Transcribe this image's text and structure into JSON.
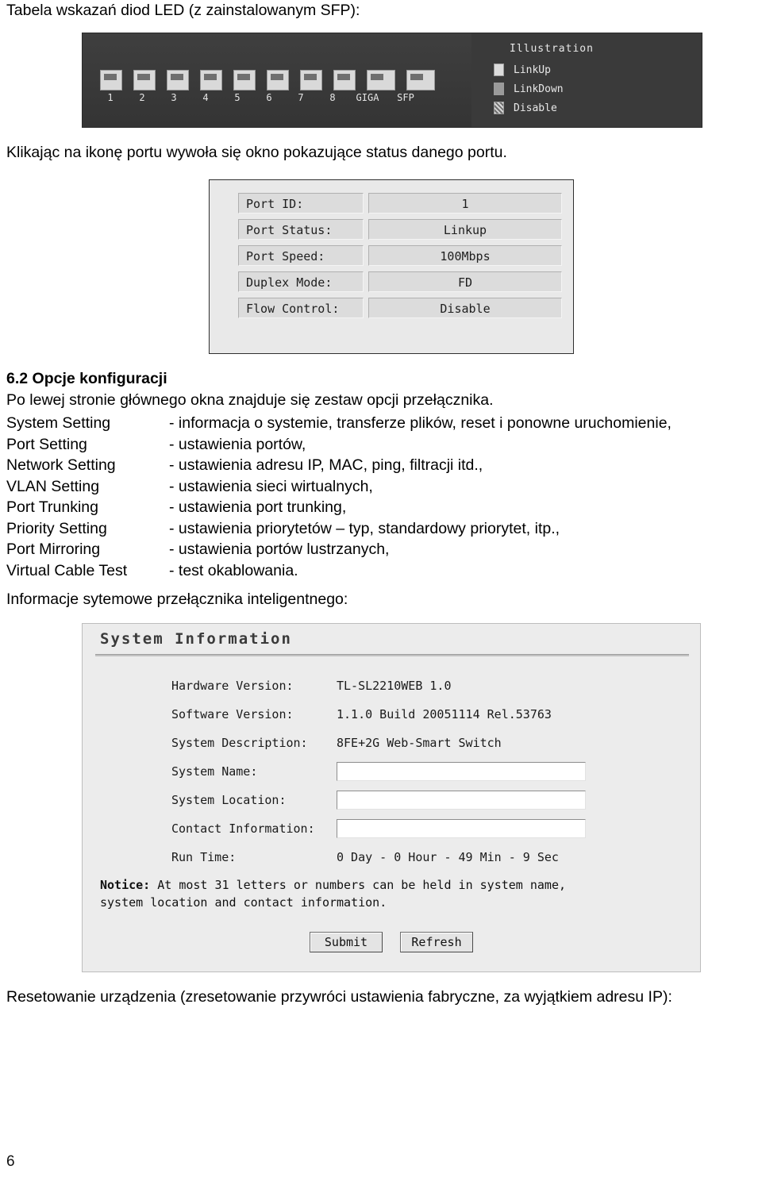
{
  "document": {
    "intro_line": "Tabela wskazań diod LED (z zainstalowanym SFP):",
    "after_led_line": "Klikając na ikonę portu wywoła się okno pokazujące status danego portu.",
    "section_heading": "6.2 Opcje konfiguracji",
    "section_intro": "Po lewej stronie głównego okna znajduje się zestaw opcji przełącznika.",
    "options_intro_note": "Informacje sytemowe przełącznika inteligentnego:",
    "closing_line": "Resetowanie urządzenia (zresetowanie przywróci ustawienia fabryczne, za wyjątkiem adresu IP):",
    "page_number": "6"
  },
  "led_figure": {
    "port_labels": [
      "1",
      "2",
      "3",
      "4",
      "5",
      "6",
      "7",
      "8",
      "GIGA",
      "SFP"
    ],
    "legend_title": "Illustration",
    "legend": [
      {
        "label": "LinkUp",
        "swatch": "light"
      },
      {
        "label": "LinkDown",
        "swatch": "dark"
      },
      {
        "label": "Disable",
        "swatch": "hatch"
      }
    ]
  },
  "port_dialog": {
    "rows": [
      {
        "label": "Port ID:",
        "value": "1"
      },
      {
        "label": "Port Status:",
        "value": "Linkup"
      },
      {
        "label": "Port Speed:",
        "value": "100Mbps"
      },
      {
        "label": "Duplex Mode:",
        "value": "FD"
      },
      {
        "label": "Flow Control:",
        "value": "Disable"
      }
    ]
  },
  "options": [
    {
      "name": "System Setting",
      "desc": "- informacja o systemie, transferze plików, reset i ponowne uruchomienie,"
    },
    {
      "name": "Port Setting",
      "desc": "- ustawienia portów,"
    },
    {
      "name": "Network Setting",
      "desc": "- ustawienia adresu IP, MAC, ping, filtracji itd.,"
    },
    {
      "name": "VLAN Setting",
      "desc": "- ustawienia sieci wirtualnych,"
    },
    {
      "name": "Port Trunking",
      "desc": "- ustawienia port trunking,"
    },
    {
      "name": "Priority Setting",
      "desc": "- ustawienia priorytetów – typ, standardowy priorytet, itp.,"
    },
    {
      "name": "Port Mirroring",
      "desc": "- ustawienia portów lustrzanych,"
    },
    {
      "name": "Virtual Cable Test",
      "desc": "- test okablowania."
    }
  ],
  "system_information": {
    "title": "System Information",
    "rows": [
      {
        "label": "Hardware Version:",
        "value": "TL-SL2210WEB 1.0",
        "type": "text"
      },
      {
        "label": "Software Version:",
        "value": "1.1.0 Build 20051114 Rel.53763",
        "type": "text"
      },
      {
        "label": "System Description:",
        "value": "8FE+2G Web-Smart Switch",
        "type": "text"
      },
      {
        "label": "System Name:",
        "value": "",
        "type": "input"
      },
      {
        "label": "System Location:",
        "value": "",
        "type": "input"
      },
      {
        "label": "Contact Information:",
        "value": "",
        "type": "input"
      },
      {
        "label": "Run Time:",
        "value": "0 Day - 0 Hour - 49 Min - 9 Sec",
        "type": "text"
      }
    ],
    "notice_prefix": "Notice:",
    "notice_line1": " At most 31 letters or numbers can be held in system name,",
    "notice_line2": "system location and contact information.",
    "submit_label": "Submit",
    "refresh_label": "Refresh"
  }
}
